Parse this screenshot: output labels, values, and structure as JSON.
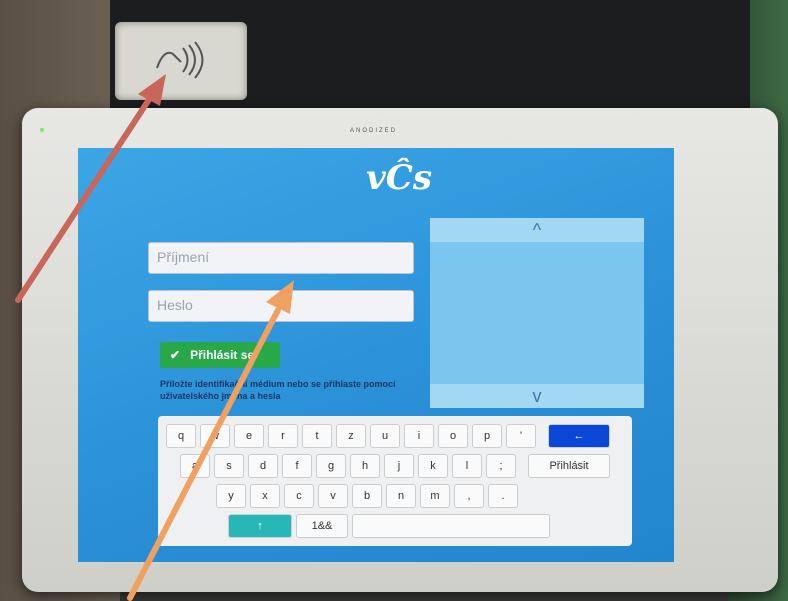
{
  "header": {
    "brand_text": "ANODIZED"
  },
  "logo": {
    "text": "vĈs"
  },
  "login_form": {
    "surname_placeholder": "Příjmení",
    "password_placeholder": "Heslo",
    "login_button_label": "Přihlásit se",
    "info_text": "Přiložte identifikační médium nebo se přihlaste pomocí uživatelského jména a hesla"
  },
  "list_panel": {
    "up_label": "^",
    "down_label": "v"
  },
  "keyboard": {
    "row1": [
      "q",
      "w",
      "e",
      "r",
      "t",
      "z",
      "u",
      "i",
      "o",
      "p",
      "'"
    ],
    "row2": [
      "a",
      "s",
      "d",
      "f",
      "g",
      "h",
      "j",
      "k",
      "l",
      ";"
    ],
    "row3": [
      "y",
      "x",
      "c",
      "v",
      "b",
      "n",
      "m",
      ",",
      "."
    ],
    "enter_label": "←",
    "login_label": "Přihlásit",
    "shift_label": "↑",
    "symbols_label": "1&&"
  },
  "colors": {
    "accent_green": "#29a84a",
    "enter_blue": "#0b47d6",
    "screen_blue": "#2a8fd6",
    "arrow_red": "#c9665a",
    "arrow_orange": "#f0a060"
  }
}
